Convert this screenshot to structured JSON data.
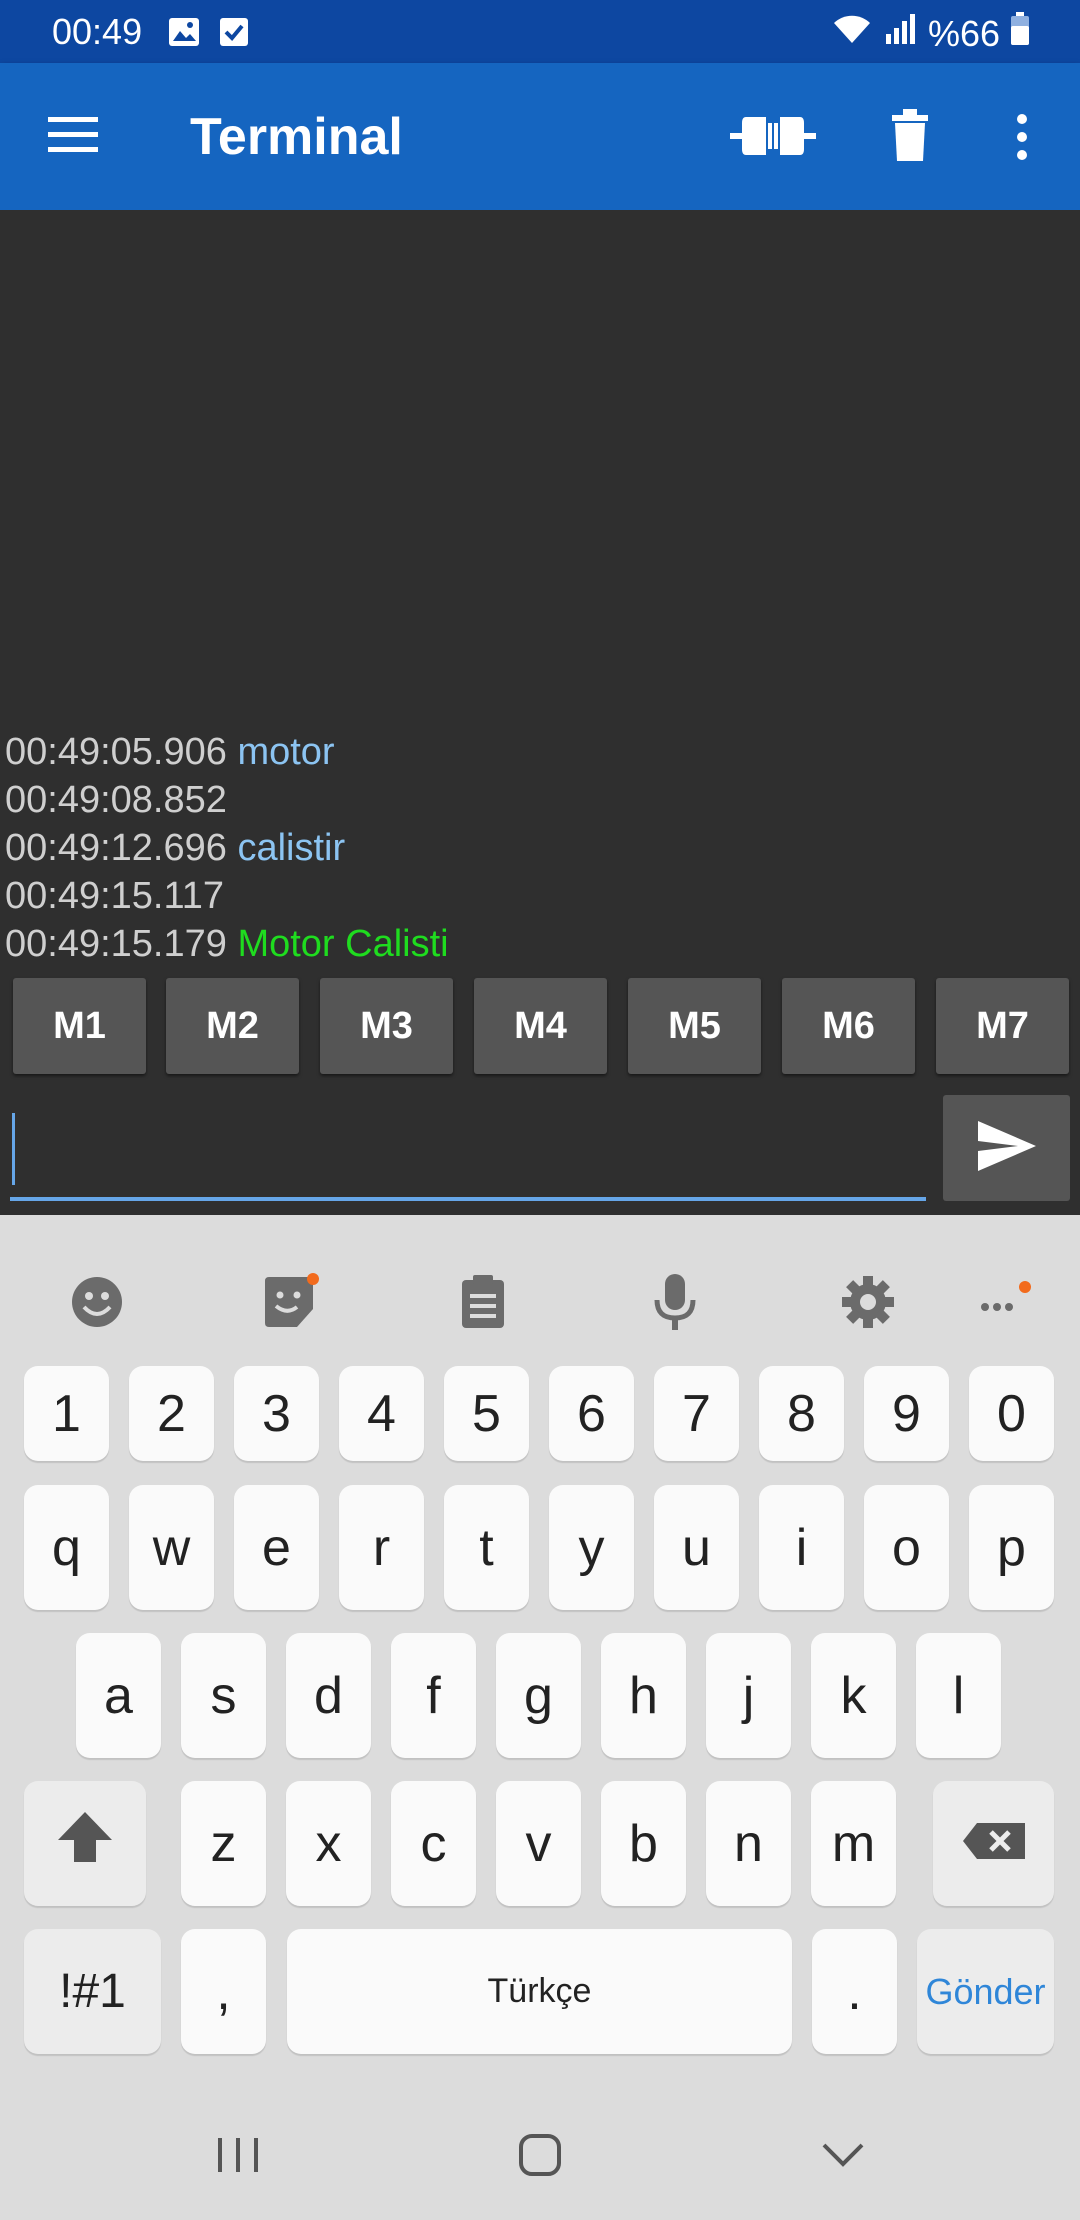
{
  "status": {
    "time": "00:49",
    "battery": "%66",
    "icons": [
      "image-icon",
      "checkbox-icon",
      "wifi-icon",
      "signal-icon",
      "battery-icon"
    ]
  },
  "appbar": {
    "title": "Terminal",
    "icons": [
      "menu-icon",
      "connect-icon",
      "delete-icon",
      "more-icon"
    ]
  },
  "log": [
    {
      "time": "00:49:05.906",
      "text": "motor",
      "kind": "sent"
    },
    {
      "time": "00:49:08.852",
      "text": "",
      "kind": "recv"
    },
    {
      "time": "00:49:12.696",
      "text": "calistir",
      "kind": "sent"
    },
    {
      "time": "00:49:15.117",
      "text": "",
      "kind": "recv"
    },
    {
      "time": "00:49:15.179",
      "text": "Motor Calisti",
      "kind": "recv"
    }
  ],
  "macros": [
    "M1",
    "M2",
    "M3",
    "M4",
    "M5",
    "M6",
    "M7"
  ],
  "input": {
    "value": "",
    "placeholder": ""
  },
  "keyboard": {
    "toolbar": [
      "emoji-icon",
      "sticker-icon",
      "clipboard-icon",
      "mic-icon",
      "settings-icon",
      "more-dots-icon"
    ],
    "row_numbers": [
      "1",
      "2",
      "3",
      "4",
      "5",
      "6",
      "7",
      "8",
      "9",
      "0"
    ],
    "row1": [
      "q",
      "w",
      "e",
      "r",
      "t",
      "y",
      "u",
      "i",
      "o",
      "p"
    ],
    "row2": [
      "a",
      "s",
      "d",
      "f",
      "g",
      "h",
      "j",
      "k",
      "l"
    ],
    "row3": [
      "z",
      "x",
      "c",
      "v",
      "b",
      "n",
      "m"
    ],
    "symbols_label": "!#1",
    "comma": ",",
    "space_label": "Türkçe",
    "period": ".",
    "send_label": "Gönder"
  },
  "colors": {
    "appbar": "#1565c0",
    "statusbar": "#0d47a1",
    "sent_text": "#8cc4f2",
    "recv_text": "#1fdc1f",
    "accent": "#66a6e8"
  }
}
